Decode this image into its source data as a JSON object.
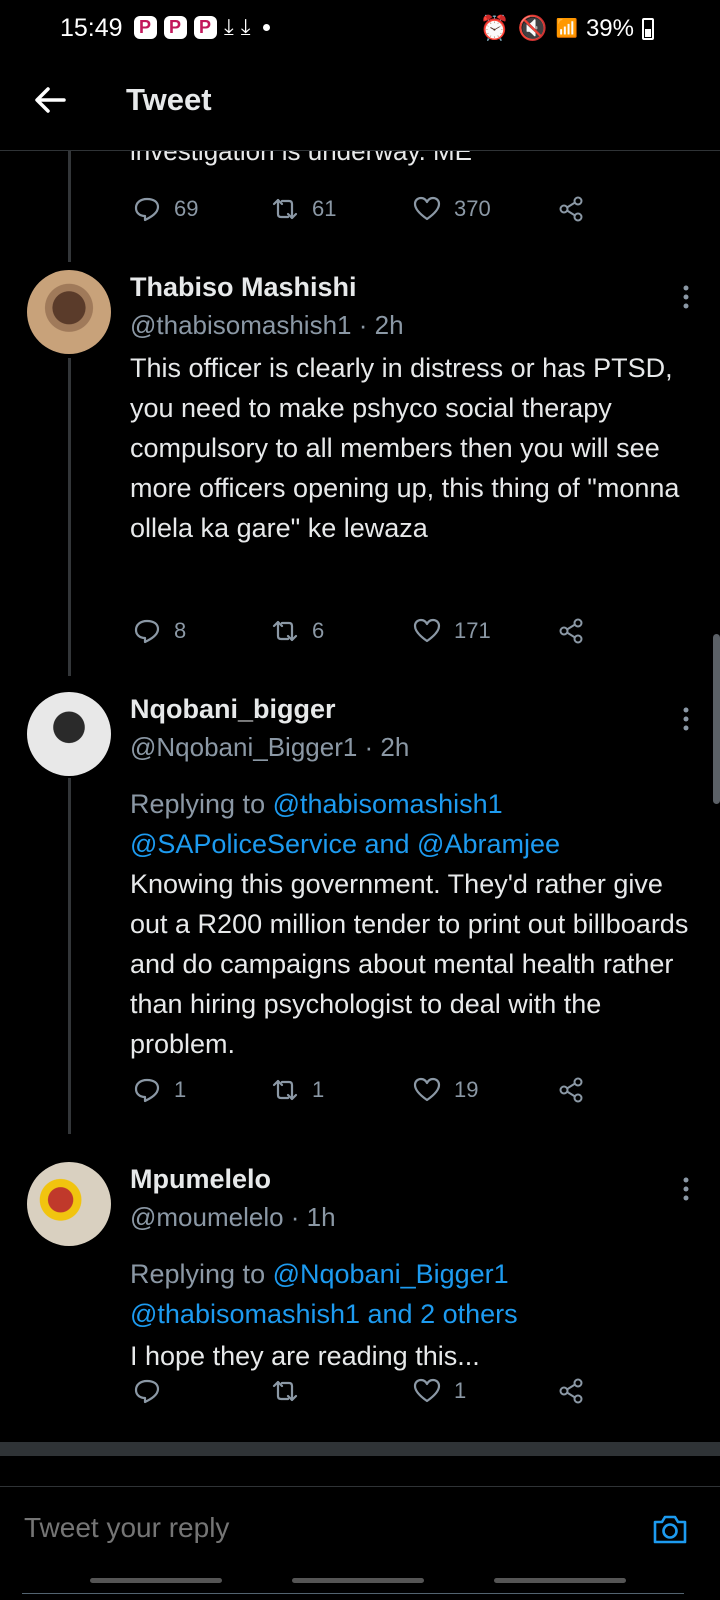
{
  "status_bar": {
    "time": "15:49",
    "battery": "39%"
  },
  "header": {
    "title": "Tweet"
  },
  "partial_tweet": {
    "text": "investigation is underway. ME",
    "actions": {
      "replies": "69",
      "retweets": "61",
      "likes": "370"
    }
  },
  "tweets": [
    {
      "name": "Thabiso Mashishi",
      "handle_time": "@thabisomashish1 · 2h",
      "text": "This officer is clearly in distress or has PTSD, you need to make pshyco social therapy compulsory to all members then you will see more officers opening up, this thing of \"monna ollela ka gare\" ke lewaza",
      "actions": {
        "replies": "8",
        "retweets": "6",
        "likes": "171"
      }
    },
    {
      "name": "Nqobani_bigger",
      "handle_time": "@Nqobani_Bigger1 · 2h",
      "replying_prefix": "Replying to ",
      "replying_line1": "@thabisomashish1",
      "replying_line2": "@SAPoliceService and @Abramjee",
      "text": "Knowing this government. They'd rather give out a R200 million tender to print out billboards and do campaigns about mental health rather than hiring psychologist to deal with the problem.",
      "actions": {
        "replies": "1",
        "retweets": "1",
        "likes": "19"
      }
    },
    {
      "name": "Mpumelelo",
      "handle_time": "@moumelelo · 1h",
      "replying_prefix": "Replying to ",
      "replying_line1": "@Nqobani_Bigger1",
      "replying_line2": "@thabisomashish1 and 2 others",
      "text": "I hope they are reading this...",
      "actions": {
        "replies": "",
        "retweets": "",
        "likes": "1"
      }
    }
  ],
  "reply": {
    "placeholder": "Tweet your reply"
  }
}
